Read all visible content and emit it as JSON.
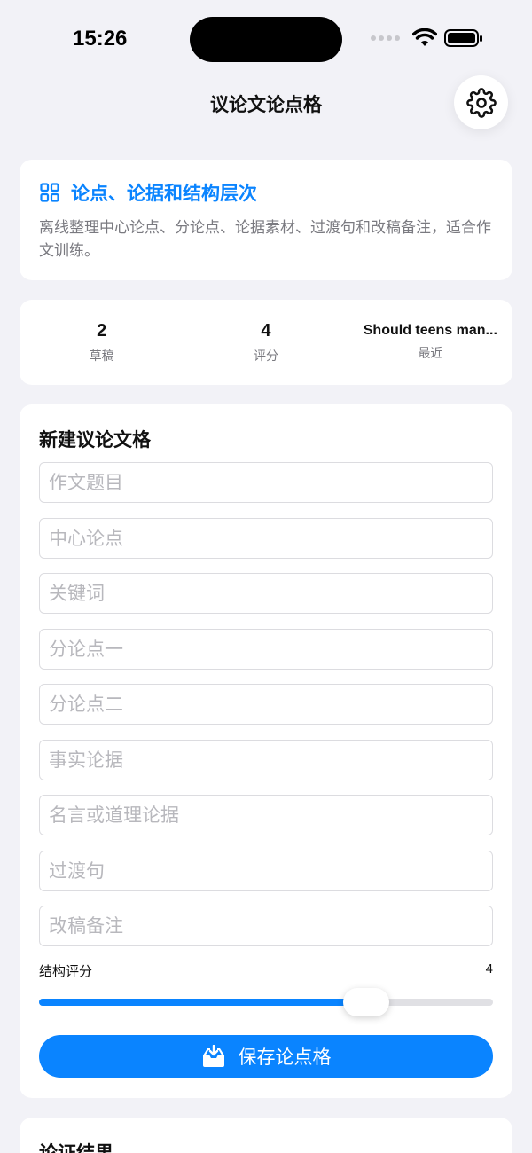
{
  "status_bar": {
    "time": "15:26"
  },
  "header": {
    "title": "议论文论点格",
    "settings_icon": "gear-icon"
  },
  "intro": {
    "icon": "grid-icon",
    "title": "论点、论据和结构层次",
    "description": "离线整理中心论点、分论点、论据素材、过渡句和改稿备注，适合作文训练。"
  },
  "stats": [
    {
      "value": "2",
      "label": "草稿"
    },
    {
      "value": "4",
      "label": "评分"
    },
    {
      "value": "Should teens man...",
      "label": "最近"
    }
  ],
  "form": {
    "title": "新建议论文格",
    "fields": [
      {
        "placeholder": "作文题目",
        "value": ""
      },
      {
        "placeholder": "中心论点",
        "value": ""
      },
      {
        "placeholder": "关键词",
        "value": ""
      },
      {
        "placeholder": "分论点一",
        "value": ""
      },
      {
        "placeholder": "分论点二",
        "value": ""
      },
      {
        "placeholder": "事实论据",
        "value": ""
      },
      {
        "placeholder": "名言或道理论据",
        "value": ""
      },
      {
        "placeholder": "过渡句",
        "value": ""
      },
      {
        "placeholder": "改稿备注",
        "value": ""
      }
    ],
    "slider": {
      "label": "结构评分",
      "value": "4",
      "fraction": 0.72
    },
    "save_button": {
      "label": "保存论点格",
      "icon": "tray-download-icon"
    }
  },
  "result": {
    "title": "论证结果"
  },
  "colors": {
    "accent": "#0a84ff",
    "background": "#f2f2f7",
    "card": "#ffffff",
    "secondary_text": "#7a7a80"
  }
}
